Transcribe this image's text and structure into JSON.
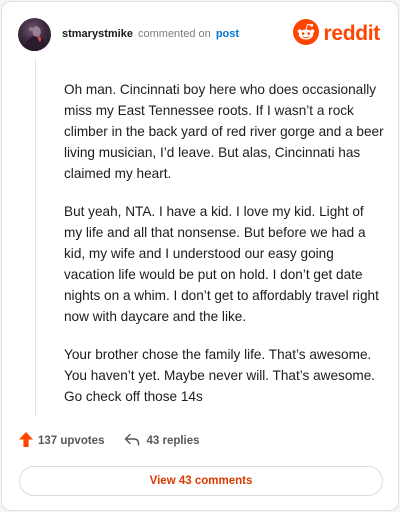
{
  "header": {
    "username": "stmarystmike",
    "action_text": "commented on",
    "post_link": "post",
    "brand": "reddit"
  },
  "comment": {
    "paragraphs": [
      "Oh man. Cincinnati boy here who does occasionally miss my East Tennessee roots. If I wasn’t a rock climber in the back yard of red river gorge and a beer living musician, I’d leave. But alas, Cincinnati has claimed my heart.",
      "But yeah, NTA. I have a kid. I love my kid. Light of my life and all that nonsense. But before we had a kid, my wife and I understood our easy going vacation life would be put on hold. I don’t get date nights on a whim. I don’t get to affordably travel right now with daycare and the like.",
      "Your brother chose the family life. That’s awesome. You haven’t yet. Maybe never will. That’s awesome. Go check off those 14s"
    ]
  },
  "footer": {
    "upvotes": "137 upvotes",
    "replies": "43 replies"
  },
  "view_comments_label": "View 43 comments",
  "colors": {
    "accent": "#ff4500",
    "link": "#0079d3",
    "button_text": "#d93a00"
  },
  "icons": [
    "reddit-logo-icon",
    "upvote-arrow-icon",
    "reply-icon"
  ]
}
